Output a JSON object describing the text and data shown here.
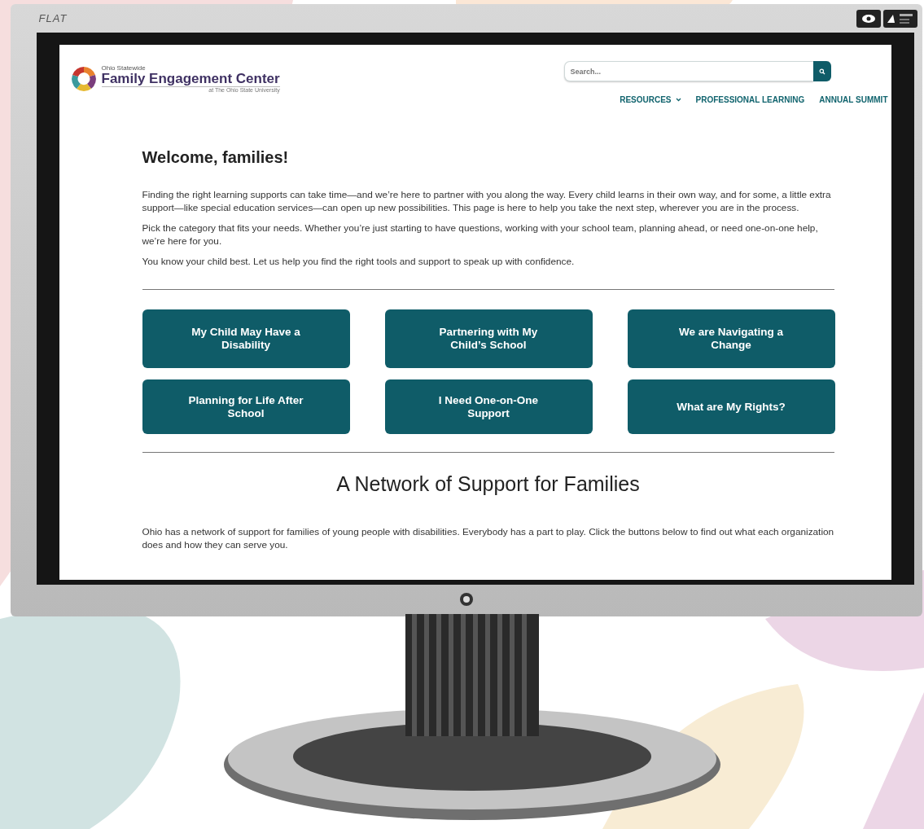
{
  "monitor": {
    "brand": "FLAT"
  },
  "site": {
    "logo": {
      "small": "Ohio Statewide",
      "name": "Family Engagement Center",
      "sub": "at The Ohio State University"
    },
    "search": {
      "placeholder": "Search..."
    },
    "nav": [
      {
        "label": "RESOURCES",
        "dropdown": true
      },
      {
        "label": "PROFESSIONAL LEARNING",
        "dropdown": false
      },
      {
        "label": "ANNUAL SUMMIT",
        "dropdown": false
      }
    ],
    "heading": "Welcome, families!",
    "paragraphs": [
      "Finding the right learning supports can take time—and we’re here to partner with you along the way. Every child learns in their own way, and for some, a little extra support—like special education services—can open up new possibilities. This page is here to help you take the next step, wherever you are in the process.",
      "Pick the category that fits your needs. Whether you’re just starting to have questions, working with your school team, planning ahead, or need one-on-one help, we’re here for you.",
      "You know your child best. Let us help you find the right tools and support to speak up with confidence."
    ],
    "category_buttons": [
      "My Child May Have a Disability",
      "Partnering with My Child’s School",
      "We are Navigating a Change",
      "Planning for Life After School",
      "I Need One-on-One Support",
      "What are My Rights?"
    ],
    "section_heading": "A Network of Support for Families",
    "section_text": "Ohio has a network of support for families of young people with disabilities. Everybody has a part to play. Click the buttons below to find out what each organization does and how they can serve you."
  }
}
